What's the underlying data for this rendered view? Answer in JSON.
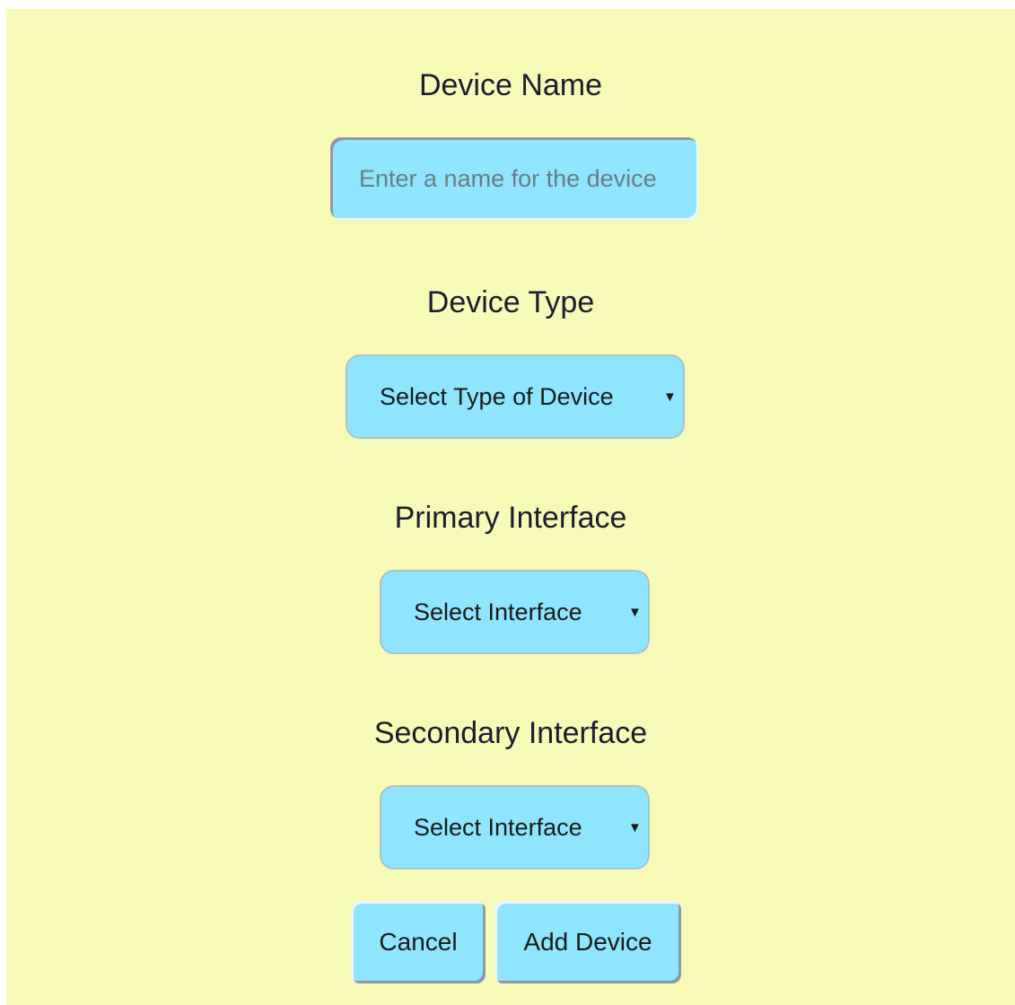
{
  "form": {
    "device_name_label": "Device Name",
    "device_name_placeholder": "Enter a name for the device",
    "device_name_value": "",
    "device_type_label": "Device Type",
    "device_type_selected": "Select Type of Device",
    "primary_interface_label": "Primary Interface",
    "primary_interface_selected": "Select Interface",
    "secondary_interface_label": "Secondary Interface",
    "secondary_interface_selected": "Select Interface"
  },
  "actions": {
    "cancel_label": "Cancel",
    "add_label": "Add Device"
  },
  "icons": {
    "dropdown": "chevron-down-icon"
  },
  "colors": {
    "background": "#f7fab7",
    "control": "#8fe5fe",
    "text": "#1c1c2e"
  }
}
